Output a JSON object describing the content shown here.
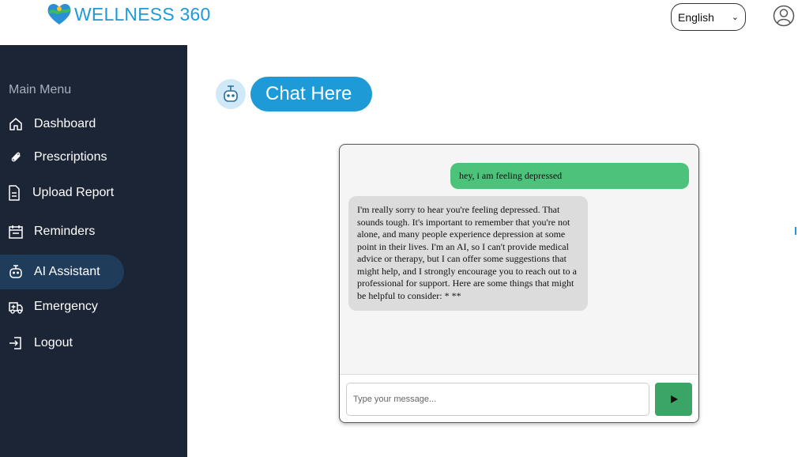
{
  "app": {
    "brand": "WELLNESS 360"
  },
  "header": {
    "language": "English"
  },
  "sidebar": {
    "title": "Main Menu",
    "items": [
      {
        "label": "Dashboard",
        "icon": "home-icon"
      },
      {
        "label": "Prescriptions",
        "icon": "paperclip-icon"
      },
      {
        "label": "Upload Report",
        "icon": "document-icon"
      },
      {
        "label": "Reminders",
        "icon": "calendar-icon"
      },
      {
        "label": "AI Assistant",
        "icon": "robot-icon",
        "active": true
      },
      {
        "label": "Emergency",
        "icon": "ambulance-icon"
      },
      {
        "label": "Logout",
        "icon": "logout-icon"
      }
    ]
  },
  "chat": {
    "heading": "Chat Here",
    "messages": [
      {
        "role": "user",
        "text": "hey, i am feeling depressed"
      },
      {
        "role": "assistant",
        "text": "I'm really sorry to hear you're feeling depressed. That sounds tough. It's important to remember that you're not alone, and many people experience depression at some point in their lives. I'm an AI, so I can't provide medical advice or therapy, but I can offer some suggestions that might help, and I strongly encourage you to reach out to a professional for support. Here are some things that might be helpful to consider: * **"
      }
    ],
    "input_placeholder": "Type your message..."
  },
  "colors": {
    "brand": "#1e9ad6",
    "sidebar": "#1c2536",
    "user_bubble": "#4cc27a",
    "send_button": "#3ba565"
  }
}
